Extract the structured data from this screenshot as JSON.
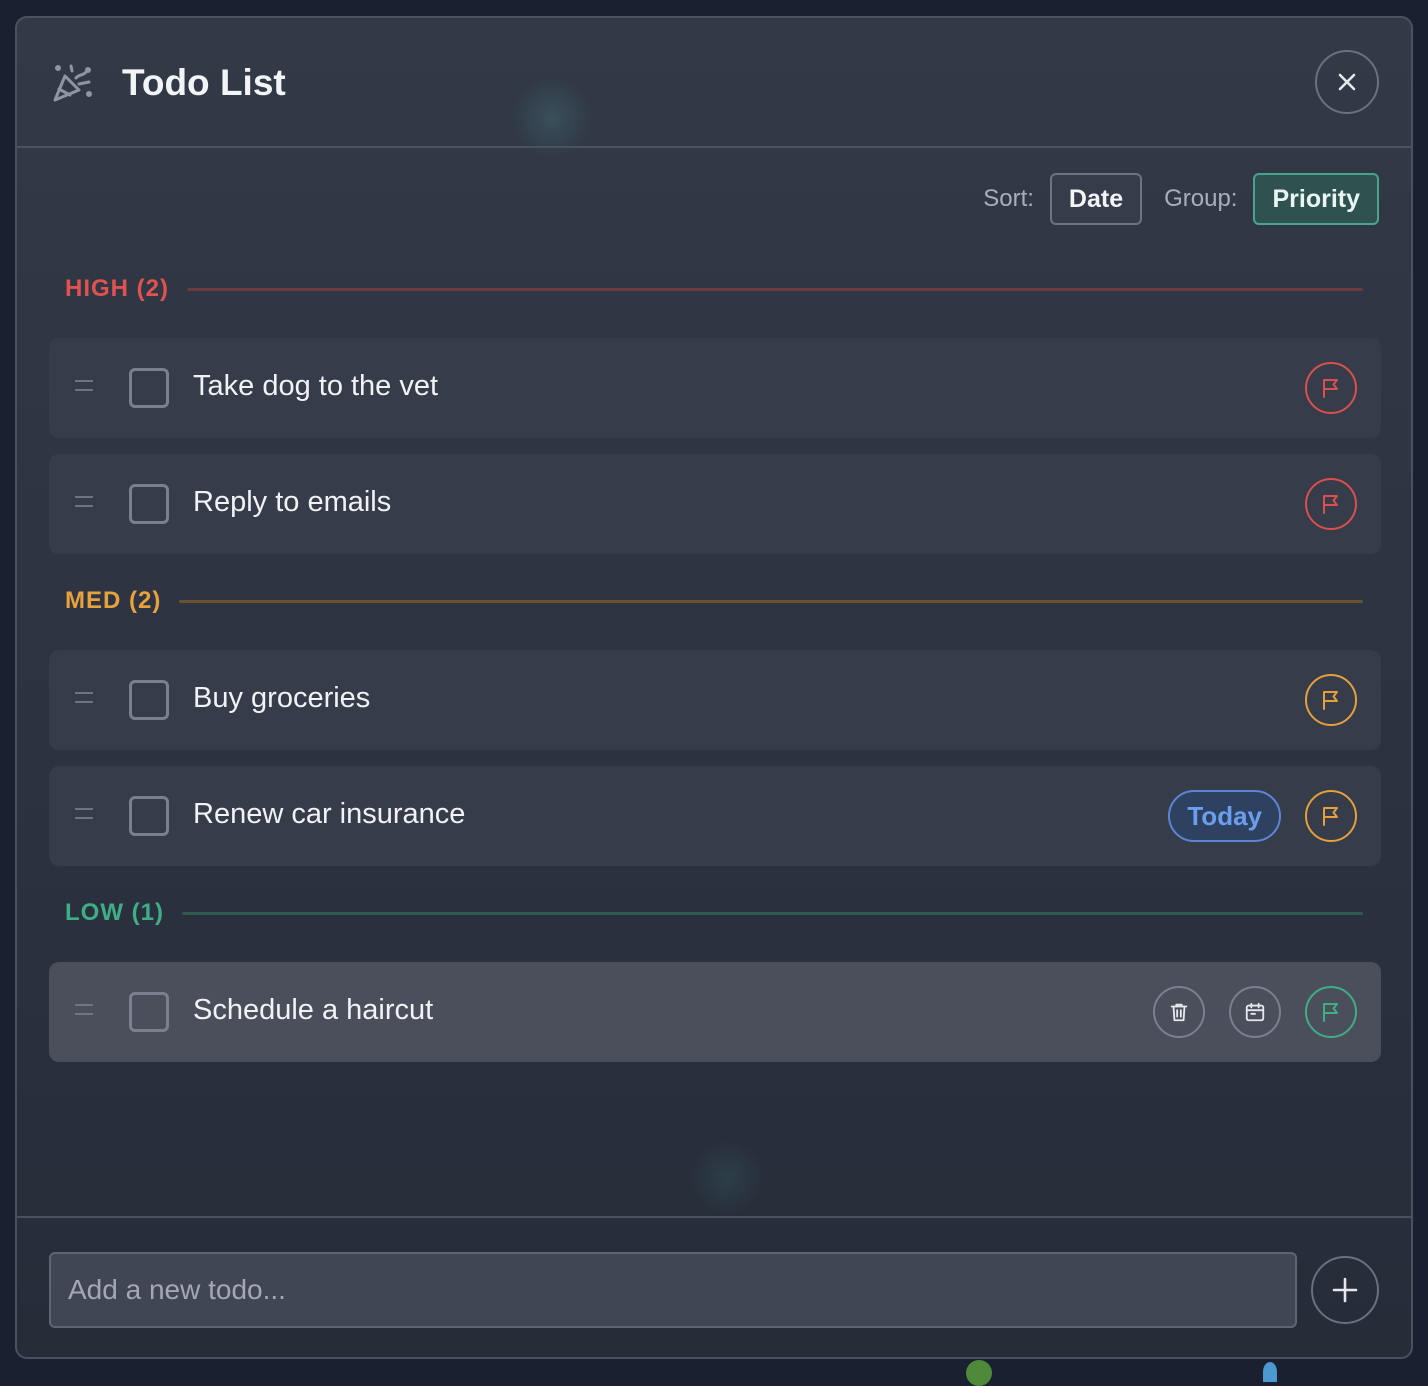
{
  "app": {
    "title": "Todo List",
    "logo_icon": "party-popper-icon",
    "close_icon": "close-icon"
  },
  "controls": {
    "sort_label": "Sort:",
    "sort_value": "Date",
    "group_label": "Group:",
    "group_value": "Priority"
  },
  "groups": [
    {
      "label": "HIGH (2)",
      "color": "#e0524f",
      "items": [
        {
          "text": "Take dog to the vet",
          "priority_color": "#d9504e"
        },
        {
          "text": "Reply to emails",
          "priority_color": "#d9504e"
        }
      ]
    },
    {
      "label": "MED (2)",
      "color": "#e8a23c",
      "items": [
        {
          "text": "Buy groceries",
          "priority_color": "#e3a03c"
        },
        {
          "text": "Renew car insurance",
          "priority_color": "#e3a03c",
          "due_badge": "Today"
        }
      ]
    },
    {
      "label": "LOW (1)",
      "color": "#3fae84",
      "items": [
        {
          "text": "Schedule a haircut",
          "priority_color": "#3fae84",
          "actions": [
            "trash-icon",
            "calendar-icon"
          ]
        }
      ]
    }
  ],
  "footer": {
    "input_placeholder": "Add a new todo...",
    "add_icon": "plus-icon"
  }
}
